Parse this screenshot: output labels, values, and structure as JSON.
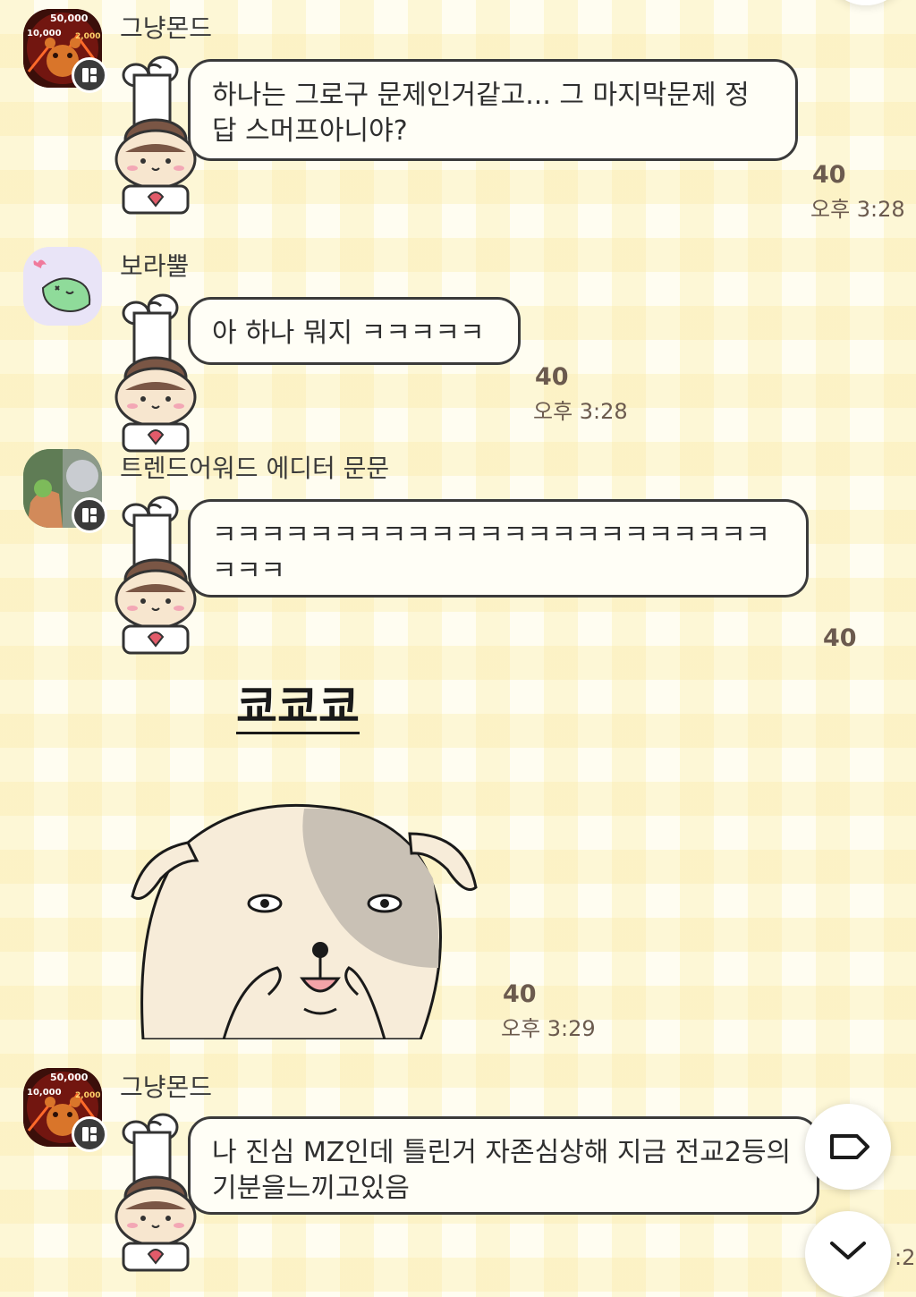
{
  "messages": [
    {
      "sender": "그냥몬드",
      "text": "하나는 그로구 문제인거같고... 그 마지막문제 정답 스머프아니야?",
      "count": "40",
      "time": "오후 3:28"
    },
    {
      "sender": "보라뿔",
      "text": "아 하나 뭐지 ㅋㅋㅋㅋㅋ",
      "count": "40",
      "time": "오후 3:28"
    },
    {
      "sender": "트렌드어워드 에디터 문문",
      "text": "ㅋㅋㅋㅋㅋㅋㅋㅋㅋㅋㅋㅋㅋㅋㅋㅋㅋㅋㅋㅋㅋㅋㅋㅋㅋㅋ",
      "count": "40",
      "sticker_caption": "쿄쿄쿄",
      "sticker_count": "40",
      "sticker_time": "오후 3:29"
    },
    {
      "sender": "그냥몬드",
      "text": "나 진심 MZ인데 틀린거 자존심상해 지금 전교2등의기분을느끼고있음"
    }
  ],
  "avatar_1_texts": [
    "50,000",
    "10,000",
    "2,000"
  ],
  "partial_time": ":2",
  "icons": [
    "bubble-profile-icon",
    "tag-icon",
    "chevron-down-icon"
  ],
  "colors": {
    "bubble_border": "#3a3a3a",
    "bubble_fill": "#fffef6",
    "count_text": "#6b5a4e",
    "background_check": "#faecaa"
  }
}
